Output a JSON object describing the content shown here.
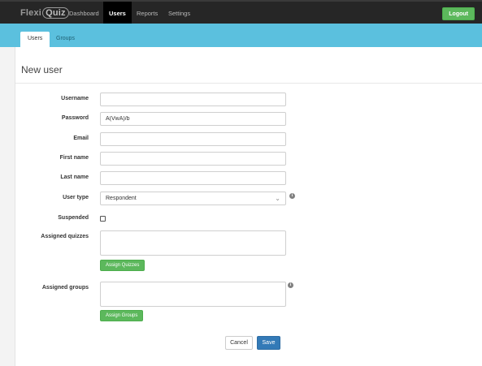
{
  "app": {
    "brand_prefix": "Flexi",
    "brand_suffix": "Quiz"
  },
  "nav": {
    "items": [
      {
        "label": "Dashboard"
      },
      {
        "label": "Users"
      },
      {
        "label": "Reports"
      },
      {
        "label": "Settings"
      }
    ],
    "logout_label": "Logout"
  },
  "subnav": {
    "items": [
      {
        "label": "Users"
      },
      {
        "label": "Groups"
      }
    ]
  },
  "page": {
    "title": "New user"
  },
  "form": {
    "username": {
      "label": "Username",
      "value": ""
    },
    "password": {
      "label": "Password",
      "value": "A(VwA)/b"
    },
    "email": {
      "label": "Email",
      "value": ""
    },
    "first_name": {
      "label": "First name",
      "value": ""
    },
    "last_name": {
      "label": "Last name",
      "value": ""
    },
    "user_type": {
      "label": "User type",
      "selected": "Respondent"
    },
    "suspended": {
      "label": "Suspended",
      "checked": false
    },
    "assigned_quizzes": {
      "label": "Assigned quizzes",
      "button": "Assign Quizzes"
    },
    "assigned_groups": {
      "label": "Assigned groups",
      "button": "Assign Groups"
    },
    "cancel_label": "Cancel",
    "save_label": "Save"
  },
  "icons": {
    "info": "info-icon",
    "dropdown": "chevron-down-icon"
  },
  "colors": {
    "topbar": "#262626",
    "subnav": "#5bc0de",
    "success": "#5cb85c",
    "primary": "#337ab7"
  }
}
